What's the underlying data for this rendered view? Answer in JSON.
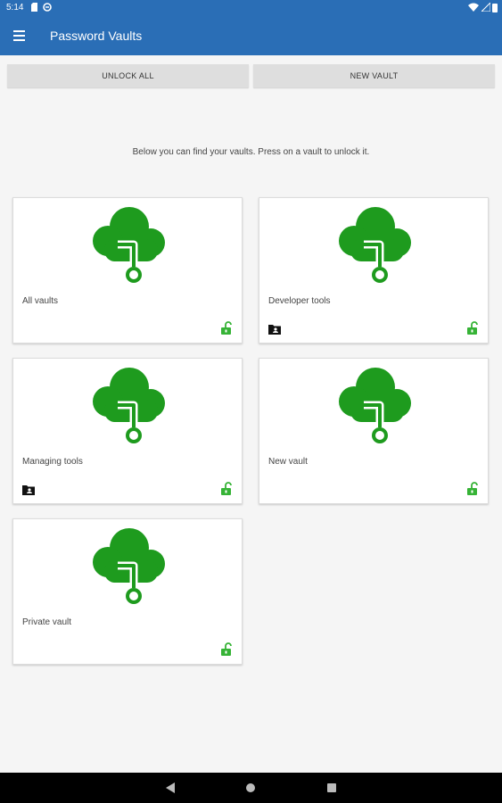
{
  "status_bar": {
    "time": "5:14"
  },
  "app_bar": {
    "title": "Password Vaults",
    "menu_icon": "hamburger-menu-icon"
  },
  "buttons": {
    "unlock_all": "UNLOCK ALL",
    "new_vault": "NEW VAULT"
  },
  "hint": "Below you can find your vaults. Press on a vault to unlock it.",
  "colors": {
    "primary": "#2a6eb6",
    "vault_green": "#1e9b1e",
    "lock_green": "#36b336"
  },
  "vaults": [
    {
      "name": "All vaults",
      "shared": false,
      "lock_state": "unlocked"
    },
    {
      "name": "Developer tools",
      "shared": true,
      "lock_state": "unlocked"
    },
    {
      "name": "Managing tools",
      "shared": true,
      "lock_state": "unlocked"
    },
    {
      "name": "New vault",
      "shared": false,
      "lock_state": "unlocked"
    },
    {
      "name": "Private vault",
      "shared": false,
      "lock_state": "unlocked"
    }
  ],
  "nav_bar": {
    "back_icon": "back-icon",
    "home_icon": "home-icon",
    "recents_icon": "recents-icon"
  }
}
